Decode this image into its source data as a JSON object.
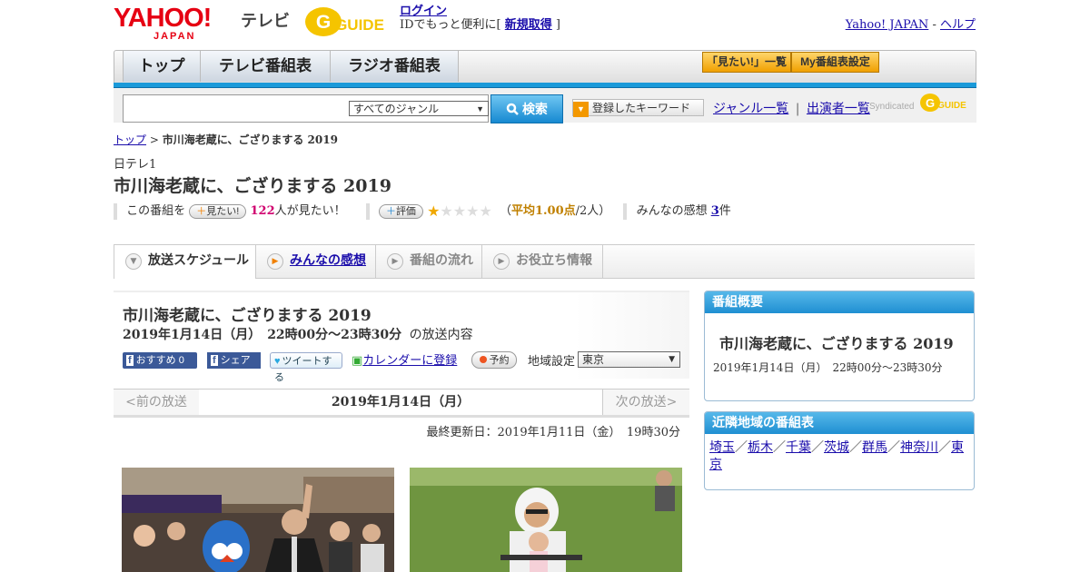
{
  "header": {
    "yahoo_logo": "YAHOO!",
    "yahoo_sub": "JAPAN",
    "tv_label": "テレビ",
    "gguide_logo": "GUIDE",
    "login": "ログイン",
    "login_note_pre": "IDでもっと便利に[ ",
    "signup": "新規取得",
    "login_note_post": " ]",
    "yahoo_japan_link": "Yahoo! JAPAN",
    "help_link": "ヘルプ",
    "link_sep": " - "
  },
  "nav": {
    "tabs": [
      "トップ",
      "テレビ番組表",
      "ラジオ番組表"
    ],
    "want_list": "「見たい!」一覧",
    "my_schedule": "My番組表設定"
  },
  "search": {
    "placeholder": "",
    "genre": "すべてのジャンル",
    "button": "検索",
    "keyword_button": "登録したキーワード",
    "genre_list": "ジャンル一覧",
    "divider": "|",
    "performer_list": "出演者一覧",
    "syndicated": "Syndicated"
  },
  "breadcrumb": {
    "top": "トップ",
    "sep": " > ",
    "current": "市川海老蔵に、ござりまする 2019"
  },
  "program": {
    "station": "日テレ1",
    "title": "市川海老蔵に、ござりまする 2019",
    "want_pre": "この番組を",
    "want_pill": "見たい!",
    "want_count": "122",
    "want_post": "人が見たい！",
    "rating_pill": "評価",
    "rating_value": 1.0,
    "rating_max": 5,
    "rating_open": "（",
    "rating_avg": "平均1.00点",
    "rating_count": "/2人）",
    "reviews_label": "みんなの感想 ",
    "reviews_count": "3",
    "reviews_unit": "件"
  },
  "tabs": [
    {
      "label": "放送スケジュール",
      "icon": "chevron-down-icon"
    },
    {
      "label": "みんなの感想",
      "icon": "play-icon"
    },
    {
      "label": "番組の流れ",
      "icon": "play-icon"
    },
    {
      "label": "お役立ち情報",
      "icon": "play-icon"
    }
  ],
  "broadcast": {
    "title": "市川海老蔵に、ござりまする 2019",
    "datetime": "2019年1月14日（月）　22時00分～23時30分",
    "datetime_suffix": "の放送内容",
    "fb_recommend": "おすすめ 0",
    "fb_share": "シェア",
    "tweet": "ツイートする",
    "calendar": "カレンダーに登録",
    "reserve": "予約",
    "region_label": "地域設定",
    "region_value": "東京",
    "prev": "<前の放送",
    "current_date": "2019年1月14日（月）",
    "next": "次の放送>",
    "updated": "最終更新日：2019年1月11日（金）　19時30分"
  },
  "sidebar": {
    "overview_head": "番組概要",
    "overview_title": "市川海老蔵に、ござりまする 2019",
    "overview_date": "2019年1月14日（月）　22時00分～23時30分",
    "nearby_head": "近隣地域の番組表",
    "regions": [
      "埼玉",
      "栃木",
      "千葉",
      "茨城",
      "群馬",
      "神奈川",
      "東京"
    ],
    "region_sep": "／"
  },
  "colors": {
    "accent_blue": "#1a9ad9",
    "yahoo_red": "#e60012",
    "link": "#1a0dab",
    "star": "#f0a800",
    "want_count": "#d0006f"
  }
}
